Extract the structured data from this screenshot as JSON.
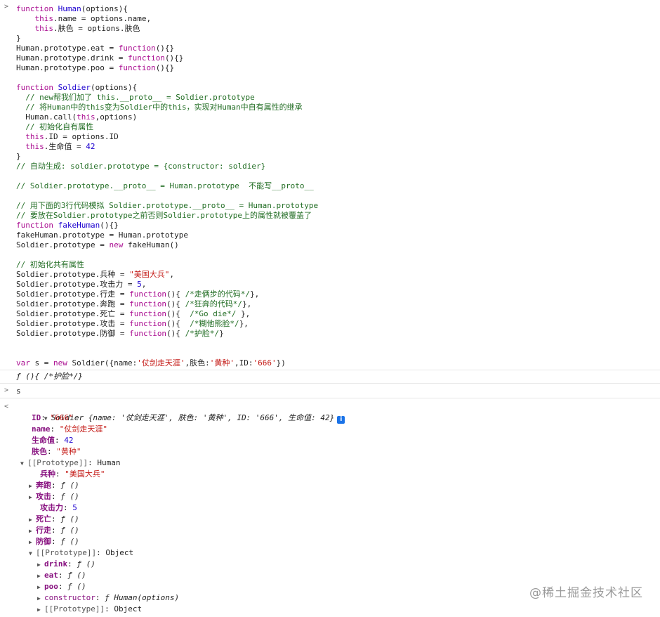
{
  "console": {
    "input_prompt": ">",
    "result_prompt": "<",
    "code_lines": [
      [
        [
          "kw",
          "function "
        ],
        [
          "fn",
          "Human"
        ],
        [
          "p",
          "(options){"
        ]
      ],
      [
        [
          "p",
          "    "
        ],
        [
          "kw",
          "this"
        ],
        [
          "p",
          ".name = options.name,"
        ]
      ],
      [
        [
          "p",
          "    "
        ],
        [
          "kw",
          "this"
        ],
        [
          "p",
          ".肤色 = options.肤色"
        ]
      ],
      [
        [
          "p",
          "}"
        ]
      ],
      [
        [
          "p",
          "Human.prototype.eat = "
        ],
        [
          "kw",
          "function"
        ],
        [
          "p",
          "(){}"
        ]
      ],
      [
        [
          "p",
          "Human.prototype.drink = "
        ],
        [
          "kw",
          "function"
        ],
        [
          "p",
          "(){}"
        ]
      ],
      [
        [
          "p",
          "Human.prototype.poo = "
        ],
        [
          "kw",
          "function"
        ],
        [
          "p",
          "(){}"
        ]
      ],
      [
        [
          "p",
          ""
        ]
      ],
      [
        [
          "kw",
          "function "
        ],
        [
          "fn",
          "Soldier"
        ],
        [
          "p",
          "(options){"
        ]
      ],
      [
        [
          "p",
          "  "
        ],
        [
          "cm",
          "// new帮我们加了 this.__proto__ = Soldier.prototype"
        ]
      ],
      [
        [
          "p",
          "  "
        ],
        [
          "cm",
          "// 将Human中的this变为Soldier中的this，实现对Human中自有属性的继承"
        ]
      ],
      [
        [
          "p",
          "  Human.call("
        ],
        [
          "kw",
          "this"
        ],
        [
          "p",
          ",options)"
        ]
      ],
      [
        [
          "p",
          "  "
        ],
        [
          "cm",
          "// 初始化自有属性"
        ]
      ],
      [
        [
          "p",
          "  "
        ],
        [
          "kw",
          "this"
        ],
        [
          "p",
          ".ID = options.ID"
        ]
      ],
      [
        [
          "p",
          "  "
        ],
        [
          "kw",
          "this"
        ],
        [
          "p",
          ".生命值 = "
        ],
        [
          "num",
          "42"
        ]
      ],
      [
        [
          "p",
          "}"
        ]
      ],
      [
        [
          "cm",
          "// 自动生成: soldier.prototype = {constructor: soldier}"
        ]
      ],
      [
        [
          "p",
          ""
        ]
      ],
      [
        [
          "cm",
          "// Soldier.prototype.__proto__ = Human.prototype  不能写__proto__"
        ]
      ],
      [
        [
          "p",
          ""
        ]
      ],
      [
        [
          "cm",
          "// 用下面的3行代码模拟 Soldier.prototype.__proto__ = Human.prototype"
        ]
      ],
      [
        [
          "cm",
          "// 要放在Soldier.prototype之前否则Soldier.prototype上的属性就被覆盖了"
        ]
      ],
      [
        [
          "kw",
          "function "
        ],
        [
          "fn",
          "fakeHuman"
        ],
        [
          "p",
          "(){}"
        ]
      ],
      [
        [
          "p",
          "fakeHuman.prototype = Human.prototype"
        ]
      ],
      [
        [
          "p",
          "Soldier.prototype = "
        ],
        [
          "kw",
          "new "
        ],
        [
          "p",
          "fakeHuman()"
        ]
      ],
      [
        [
          "p",
          ""
        ]
      ],
      [
        [
          "cm",
          "// 初始化共有属性"
        ]
      ],
      [
        [
          "p",
          "Soldier.prototype.兵种 = "
        ],
        [
          "str",
          "\"美国大兵\""
        ],
        [
          "p",
          ","
        ]
      ],
      [
        [
          "p",
          "Soldier.prototype.攻击力 = "
        ],
        [
          "num",
          "5"
        ],
        [
          "p",
          ","
        ]
      ],
      [
        [
          "p",
          "Soldier.prototype.行走 = "
        ],
        [
          "kw",
          "function"
        ],
        [
          "p",
          "(){ "
        ],
        [
          "cm",
          "/*走俩步的代码*/"
        ],
        [
          "p",
          "},"
        ]
      ],
      [
        [
          "p",
          "Soldier.prototype.奔跑 = "
        ],
        [
          "kw",
          "function"
        ],
        [
          "p",
          "(){ "
        ],
        [
          "cm",
          "/*狂奔的代码*/"
        ],
        [
          "p",
          "},"
        ]
      ],
      [
        [
          "p",
          "Soldier.prototype.死亡 = "
        ],
        [
          "kw",
          "function"
        ],
        [
          "p",
          "(){  "
        ],
        [
          "cm",
          "/*Go die*/"
        ],
        [
          "p",
          " },"
        ]
      ],
      [
        [
          "p",
          "Soldier.prototype.攻击 = "
        ],
        [
          "kw",
          "function"
        ],
        [
          "p",
          "(){  "
        ],
        [
          "cm",
          "/*糊他熊脸*/"
        ],
        [
          "p",
          "},"
        ]
      ],
      [
        [
          "p",
          "Soldier.prototype.防御 = "
        ],
        [
          "kw",
          "function"
        ],
        [
          "p",
          "(){ "
        ],
        [
          "cm",
          "/*护脸*/"
        ],
        [
          "p",
          "}"
        ]
      ],
      [
        [
          "p",
          ""
        ]
      ],
      [
        [
          "p",
          ""
        ]
      ],
      [
        [
          "kw",
          "var "
        ],
        [
          "p",
          "s = "
        ],
        [
          "kw",
          "new "
        ],
        [
          "p",
          "Soldier({name:"
        ],
        [
          "str",
          "'仗剑走天涯'"
        ],
        [
          "p",
          ",肤色:"
        ],
        [
          "str",
          "'黄种'"
        ],
        [
          "p",
          ",ID:"
        ],
        [
          "str",
          "'666'"
        ],
        [
          "p",
          "})"
        ]
      ]
    ],
    "code_result": "ƒ (){ /*护脸*/}",
    "input_2": "s",
    "object_summary": {
      "class_name": "Soldier",
      "text": "{name: '仗剑走天涯', 肤色: '黄种', ID: '666', 生命值: 42}",
      "info_icon": "i"
    },
    "tree": [
      {
        "indent": 1,
        "tri": "",
        "key": "ID",
        "kind": "own",
        "value": "\"666\"",
        "vtype": "str"
      },
      {
        "indent": 1,
        "tri": "",
        "key": "name",
        "kind": "own",
        "value": "\"仗剑走天涯\"",
        "vtype": "str"
      },
      {
        "indent": 1,
        "tri": "",
        "key": "生命值",
        "kind": "own",
        "value": "42",
        "vtype": "num"
      },
      {
        "indent": 1,
        "tri": "",
        "key": "肤色",
        "kind": "own",
        "value": "\"黄种\"",
        "vtype": "str"
      },
      {
        "indent": 0.5,
        "tri": "▼",
        "key": "[[Prototype]]",
        "kind": "internal",
        "value": "Human",
        "vtype": "plain"
      },
      {
        "indent": 2,
        "tri": "",
        "key": "兵种",
        "kind": "own",
        "value": "\"美国大兵\"",
        "vtype": "str"
      },
      {
        "indent": 1.5,
        "tri": "▶",
        "key": "奔跑",
        "kind": "own",
        "value": "ƒ ()",
        "vtype": "fn"
      },
      {
        "indent": 1.5,
        "tri": "▶",
        "key": "攻击",
        "kind": "own",
        "value": "ƒ ()",
        "vtype": "fn"
      },
      {
        "indent": 2,
        "tri": "",
        "key": "攻击力",
        "kind": "own",
        "value": "5",
        "vtype": "num"
      },
      {
        "indent": 1.5,
        "tri": "▶",
        "key": "死亡",
        "kind": "own",
        "value": "ƒ ()",
        "vtype": "fn"
      },
      {
        "indent": 1.5,
        "tri": "▶",
        "key": "行走",
        "kind": "own",
        "value": "ƒ ()",
        "vtype": "fn"
      },
      {
        "indent": 1.5,
        "tri": "▶",
        "key": "防御",
        "kind": "own",
        "value": "ƒ ()",
        "vtype": "fn"
      },
      {
        "indent": 1.5,
        "tri": "▼",
        "key": "[[Prototype]]",
        "kind": "internal",
        "value": "Object",
        "vtype": "plain"
      },
      {
        "indent": 2.5,
        "tri": "▶",
        "key": "drink",
        "kind": "own",
        "value": "ƒ ()",
        "vtype": "fn"
      },
      {
        "indent": 2.5,
        "tri": "▶",
        "key": "eat",
        "kind": "own",
        "value": "ƒ ()",
        "vtype": "fn"
      },
      {
        "indent": 2.5,
        "tri": "▶",
        "key": "poo",
        "kind": "own",
        "value": "ƒ ()",
        "vtype": "fn"
      },
      {
        "indent": 2.5,
        "tri": "▶",
        "key": "constructor",
        "kind": "proto",
        "value": "ƒ Human(options)",
        "vtype": "fn"
      },
      {
        "indent": 2.5,
        "tri": "▶",
        "key": "[[Prototype]]",
        "kind": "internal",
        "value": "Object",
        "vtype": "plain"
      }
    ]
  },
  "watermark": "@稀土掘金技术社区",
  "colors": {
    "keyword": "#aa0d91",
    "function_name": "#1c00cf",
    "string": "#c41a16",
    "comment": "#236e25",
    "property_key": "#881280",
    "info_icon": "#1a73e8"
  }
}
